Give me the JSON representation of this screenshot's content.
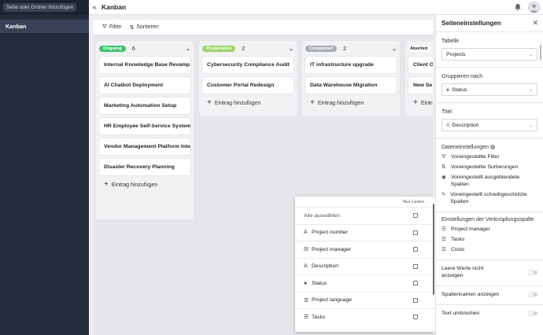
{
  "sidebar": {
    "search_placeholder": "Seite oder Ordner hinzufügen",
    "items": [
      {
        "label": "Kanban"
      }
    ]
  },
  "header": {
    "title": "Kanban"
  },
  "toolbar": {
    "filter_label": "Filter",
    "sort_label": "Sortieren"
  },
  "board": {
    "add_entry_label": "Eintrag hinzufügen",
    "columns": [
      {
        "status": "Ongoing",
        "color": "#3ec46d",
        "count": "6",
        "cards": [
          "Internal Knowledge Base Revamp",
          "AI Chatbot Deployment",
          "Marketing Automation Setup",
          "HR Employee Self-Service System",
          "Vendor Management Platform Inte...",
          "Disaster Recovery Planning"
        ]
      },
      {
        "status": "Preparation",
        "color": "#9fd46a",
        "count": "2",
        "cards": [
          "Cybersecurity Compliance Audit",
          "Customer Portal Redesign"
        ]
      },
      {
        "status": "Completed",
        "color": "#a9acb2",
        "count": "2",
        "cards": [
          "IT infrastructure upgrade",
          "Data Warehouse Migration"
        ]
      },
      {
        "status": "Aborted",
        "color": "#ffffff",
        "count": "",
        "cards": [
          "Client O",
          "New Se"
        ]
      }
    ]
  },
  "dropdown": {
    "header": "Nur Lesen",
    "select_all": "Alle auswählen",
    "rows": [
      {
        "icon": "text-icon",
        "glyph": "A",
        "label": "Project number"
      },
      {
        "icon": "person-icon",
        "glyph": "☒",
        "label": "Project manager"
      },
      {
        "icon": "text-icon",
        "glyph": "A",
        "label": "Description"
      },
      {
        "icon": "status-icon",
        "glyph": "●",
        "label": "Status"
      },
      {
        "icon": "list-icon",
        "glyph": "☰",
        "label": "Project language"
      },
      {
        "icon": "list-icon",
        "glyph": "☰",
        "label": "Tasks"
      }
    ]
  },
  "panel": {
    "title": "Seiteneinstellungen",
    "table_label": "Tabelle",
    "table_value": "Projects",
    "group_label": "Gruppieren nach",
    "group_value": "Status",
    "title_label": "Titel",
    "title_value": "Description",
    "data_settings_label": "Dateneinstellungen",
    "data_items": [
      {
        "icon": "filter-icon",
        "glyph": "⛛",
        "label": "Voreingestellte Filter"
      },
      {
        "icon": "sort-icon",
        "glyph": "⇅",
        "label": "Voreingestellte Sortierungen"
      },
      {
        "icon": "eye-icon",
        "glyph": "◉",
        "label": "Voreingestellt ausgeblendete Spalten"
      },
      {
        "icon": "pencil-off-icon",
        "glyph": "✎",
        "label": "Voreingestellt schreibgeschützte Spalten"
      }
    ],
    "link_settings_label": "Einstellungen der Verknüpfungsspalte",
    "link_items": [
      {
        "icon": "list-icon",
        "glyph": "☰",
        "label": "Project manager"
      },
      {
        "icon": "list-icon",
        "glyph": "☰",
        "label": "Tasks"
      },
      {
        "icon": "list-icon",
        "glyph": "☰",
        "label": "Costs"
      }
    ],
    "toggles": [
      {
        "label": "Leere Werte nicht anzeigen"
      },
      {
        "label": "Spaltennamen anzeigen"
      },
      {
        "label": "Text umbrechen"
      }
    ]
  }
}
